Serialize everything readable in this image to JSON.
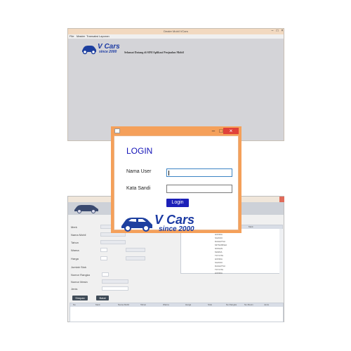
{
  "main_window": {
    "title": "Dealer Mobil VCars",
    "menu": [
      "File",
      "Master",
      "Transaksi",
      "Laporan"
    ],
    "welcome_text": "Selamat Datang di SIM Aplikasi Penjualan Mobil"
  },
  "logo": {
    "brand": "V Cars",
    "tagline": "since 2000"
  },
  "form_window": {
    "labels": [
      "Merk",
      "Nama Mobil",
      "Tahun",
      "Warna",
      "Harga",
      "Jumlah Stok",
      "Nomor Rangka",
      "Nomor Mesin",
      "Jenis"
    ],
    "buttons": [
      "Simpan",
      "Batal"
    ],
    "right_table_header": "Merk",
    "right_table_rows": [
      "TOYOTA",
      "HONDA",
      "SUZUKI",
      "DAIHATSU",
      "MITSUBISHI",
      "NISSAN",
      "MAZDA",
      "TOYOTA",
      "HONDA",
      "SUZUKI",
      "DAIHATSU",
      "TOYOTA",
      "HONDA"
    ],
    "bottom_table_columns": [
      "No",
      "Merk",
      "Nama Mobil",
      "Tahun",
      "Warna",
      "Harga",
      "Stok",
      "No Rangka",
      "No Mesin",
      "Jenis"
    ]
  },
  "login_dialog": {
    "heading": "LOGIN",
    "username_label": "Nama User",
    "password_label": "Kata Sandi",
    "username_value": "",
    "password_value": "",
    "login_button": "Login"
  },
  "colors": {
    "dialog_frame": "#f5a05a",
    "heading": "#1414b8",
    "button": "#1c20b8",
    "logo": "#1b3aa3"
  }
}
